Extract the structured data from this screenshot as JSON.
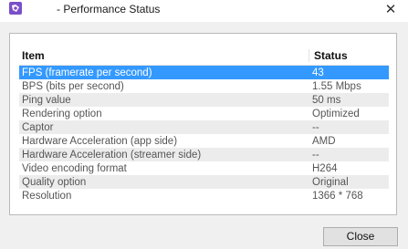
{
  "window": {
    "title": "- Performance Status",
    "close_glyph": "✕",
    "app_icon": "puzzle-app-icon",
    "accent_color": "#3399ff"
  },
  "table": {
    "headers": {
      "item": "Item",
      "status": "Status"
    },
    "rows": [
      {
        "item": "FPS (framerate per second)",
        "status": "43"
      },
      {
        "item": "BPS (bits per second)",
        "status": "1.55 Mbps"
      },
      {
        "item": "Ping value",
        "status": "50 ms"
      },
      {
        "item": "Rendering option",
        "status": "Optimized"
      },
      {
        "item": "Captor",
        "status": "--"
      },
      {
        "item": "Hardware Acceleration (app side)",
        "status": "AMD"
      },
      {
        "item": "Hardware Acceleration (streamer side)",
        "status": "--"
      },
      {
        "item": "Video encoding format",
        "status": "H264"
      },
      {
        "item": "Quality option",
        "status": "Original"
      },
      {
        "item": "Resolution",
        "status": "1366 * 768"
      }
    ],
    "selected_row": 0
  },
  "footer": {
    "close_label": "Close"
  }
}
